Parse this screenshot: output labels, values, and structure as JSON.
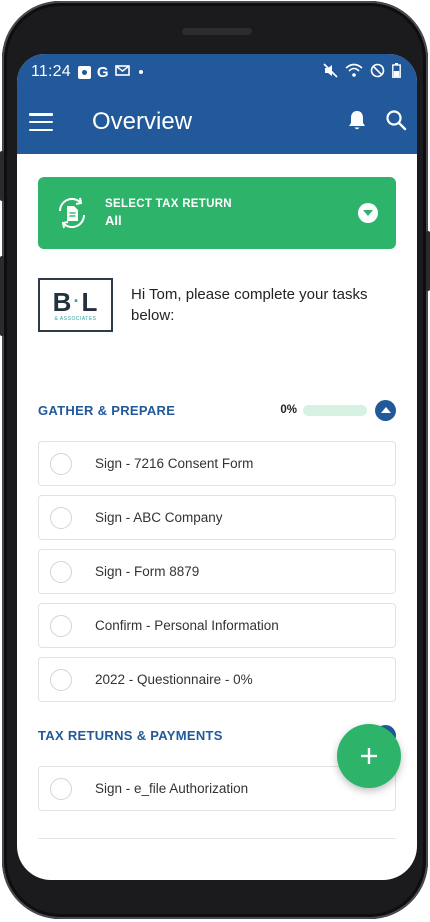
{
  "status_bar": {
    "time": "11:24",
    "left_icons": [
      "photo-icon",
      "google-icon",
      "mail-icon",
      "dot-icon"
    ],
    "right_icons": [
      "mute-icon",
      "wifi-icon",
      "do-not-disturb-icon",
      "battery-icon"
    ]
  },
  "app_bar": {
    "title": "Overview",
    "menu_icon": "menu-icon",
    "actions": [
      "bell-icon",
      "search-icon"
    ]
  },
  "tax_return_selector": {
    "label": "SELECT TAX RETURN",
    "value": "All",
    "icon": "document-sync-icon",
    "caret_icon": "chevron-down-icon"
  },
  "firm": {
    "logo_text": "B·L",
    "logo_subtext": "& ASSOCIATES"
  },
  "greeting": "Hi Tom, please complete your tasks below:",
  "sections": [
    {
      "title": "GATHER & PREPARE",
      "progress_text": "0%",
      "progress": 0,
      "expanded": true,
      "tasks": [
        {
          "label": "Sign - 7216 Consent Form"
        },
        {
          "label": "Sign - ABC Company"
        },
        {
          "label": "Sign - Form 8879"
        },
        {
          "label": "Confirm - Personal Information"
        },
        {
          "label": "2022 - Questionnaire - 0%"
        }
      ]
    },
    {
      "title": "TAX RETURNS & PAYMENTS",
      "expanded": true,
      "tasks": [
        {
          "label": "Sign - e_file Authorization"
        }
      ]
    }
  ],
  "fab": {
    "icon": "plus-icon"
  },
  "colors": {
    "primary": "#21599a",
    "accent_green": "#2db46a",
    "logo_teal": "#2aa9a0"
  }
}
